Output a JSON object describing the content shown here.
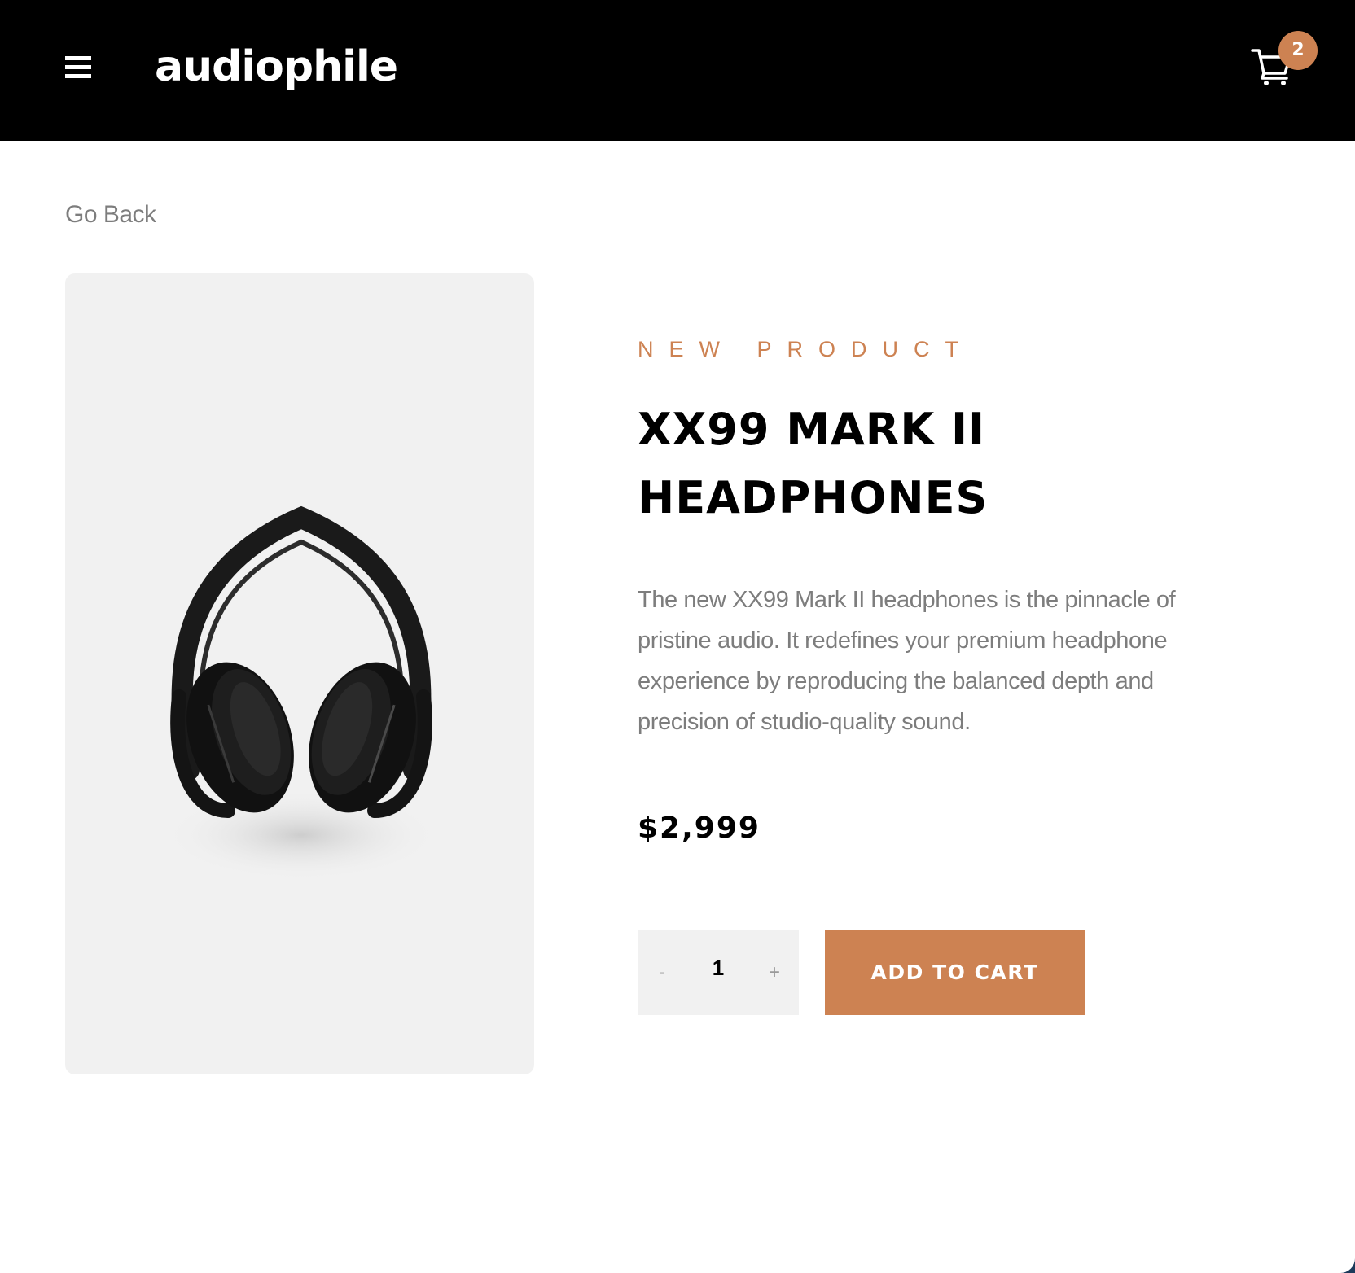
{
  "header": {
    "logo": "audiophile",
    "menu_icon": "hamburger-menu-icon",
    "cart_icon": "shopping-cart-icon",
    "cart_count": "2"
  },
  "nav": {
    "go_back": "Go Back"
  },
  "product": {
    "kicker": "NEW PRODUCT",
    "title": "XX99 MARK II HEADPHONES",
    "description": "The new XX99 Mark II headphones is the pinnacle of pristine audio. It redefines your premium headphone experience by reproducing the balanced depth and precision of studio-quality sound.",
    "price": "$2,999",
    "image_icon": "headphones-image"
  },
  "purchase": {
    "decrement_label": "-",
    "quantity": "1",
    "increment_label": "+",
    "add_to_cart_label": "ADD TO CART"
  },
  "colors": {
    "accent": "#cd8252",
    "header_bg": "#000000",
    "card_bg": "#f1f1f1",
    "body_text": "#7d7d7d"
  }
}
